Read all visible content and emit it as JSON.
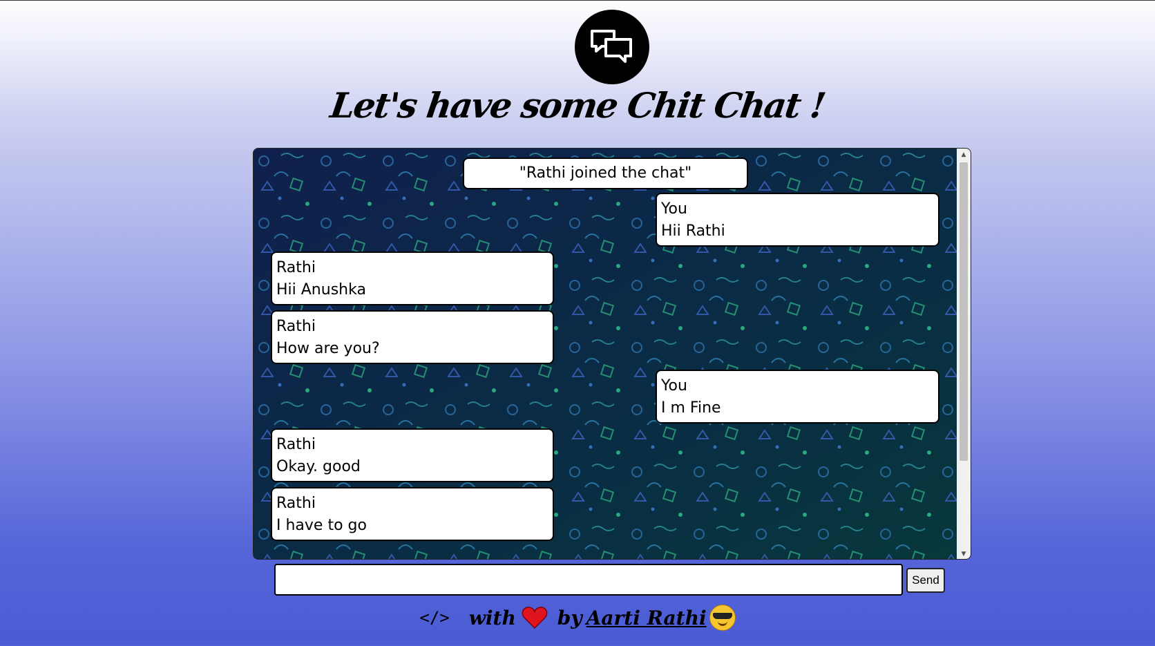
{
  "header": {
    "logo_icon": "chat-bubbles-icon",
    "title": "Let's have some Chit Chat !"
  },
  "chat": {
    "notice": "\"Rathi joined the chat\"",
    "messages": [
      {
        "sender": "You",
        "text": "Hii Rathi",
        "side": "right"
      },
      {
        "sender": "Rathi",
        "text": "Hii Anushka",
        "side": "left"
      },
      {
        "sender": "Rathi",
        "text": "How are you?",
        "side": "left"
      },
      {
        "sender": "You",
        "text": "I m Fine",
        "side": "right"
      },
      {
        "sender": "Rathi",
        "text": "Okay. good",
        "side": "left"
      },
      {
        "sender": "Rathi",
        "text": "I have to go",
        "side": "left"
      }
    ]
  },
  "composer": {
    "input_value": "",
    "send_label": "Send"
  },
  "footer": {
    "code_symbol": "</>",
    "with_text": "with",
    "heart_icon": "heart-icon",
    "by_text": "by",
    "author": "Aarti Rathi",
    "emoji_icon": "sunglasses-emoji-icon"
  },
  "colors": {
    "chat_background": "#061532",
    "bubble": "#ffffff",
    "logo_circle": "#000000",
    "heart": "#e0141e"
  }
}
